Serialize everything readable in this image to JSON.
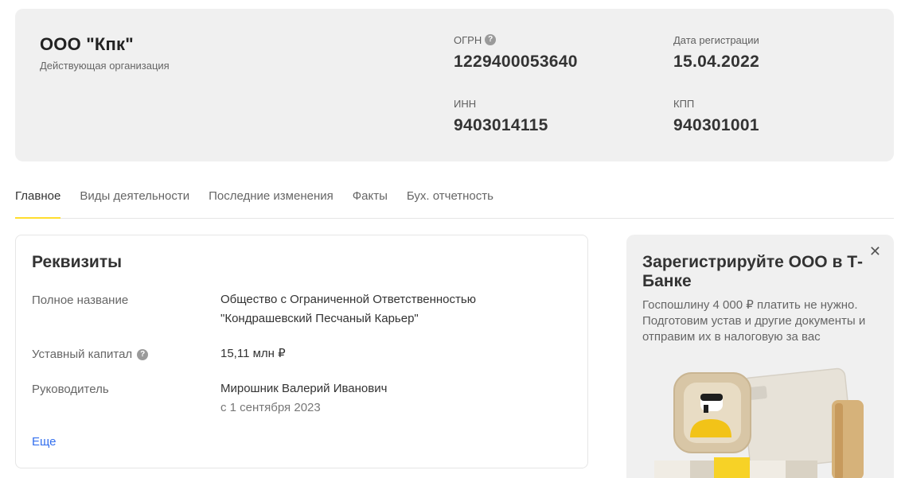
{
  "company": {
    "name": "ООО \"Кпк\"",
    "status": "Действующая организация",
    "ogrn_label": "ОГРН",
    "ogrn_value": "1229400053640",
    "reg_date_label": "Дата регистрации",
    "reg_date_value": "15.04.2022",
    "inn_label": "ИНН",
    "inn_value": "9403014115",
    "kpp_label": "КПП",
    "kpp_value": "940301001"
  },
  "tabs": [
    {
      "label": "Главное",
      "active": true
    },
    {
      "label": "Виды деятельности",
      "active": false
    },
    {
      "label": "Последние изменения",
      "active": false
    },
    {
      "label": "Факты",
      "active": false
    },
    {
      "label": "Бух. отчетность",
      "active": false
    }
  ],
  "requisites": {
    "title": "Реквизиты",
    "full_name_label": "Полное название",
    "full_name_value": "Общество с Ограниченной Ответственностью \"Кондрашевский Песчаный Карьер\"",
    "capital_label": "Уставный капитал",
    "capital_value": "15,11 млн ₽",
    "director_label": "Руководитель",
    "director_value": "Мирошник Валерий Иванович",
    "director_since": "с 1 сентября 2023",
    "more_label": "Еще"
  },
  "promo": {
    "title": "Зарегистрируйте ООО в Т-Банке",
    "text": "Госпошлину 4 000 ₽ платить не нужно. Подготовим устав и другие документы и отправим их в налоговую за вас",
    "close_icon": "close-icon"
  },
  "colors": {
    "accent": "#ffdd2d",
    "link": "#336fee",
    "card_bg": "#f0f0f0"
  }
}
